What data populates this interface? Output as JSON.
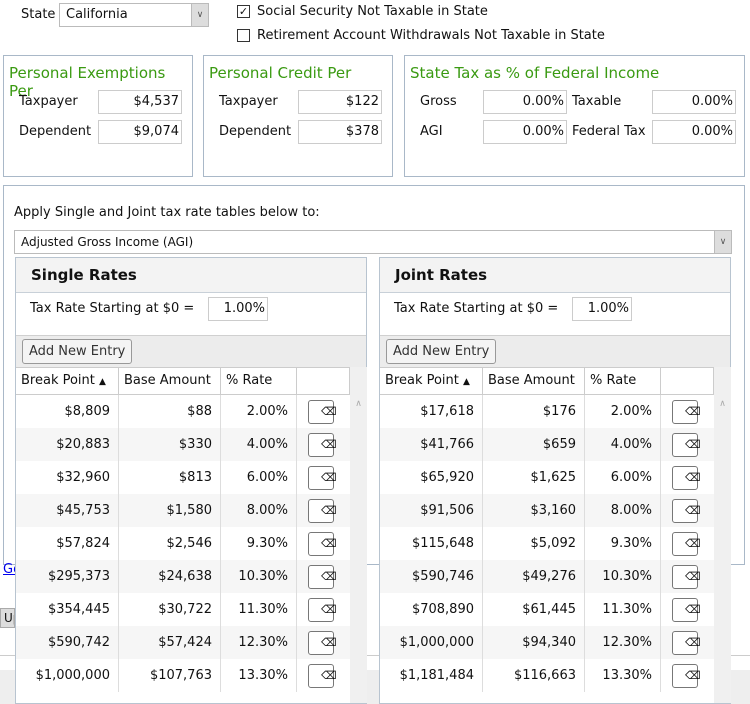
{
  "state": {
    "label": "State",
    "value": "California"
  },
  "options": [
    {
      "label": "Social Security Not Taxable in State",
      "checked": true
    },
    {
      "label": "Retirement Account Withdrawals Not Taxable in State",
      "checked": false
    }
  ],
  "exemptions": {
    "title": "Personal Exemptions Per",
    "taxpayer_label": "Taxpayer",
    "taxpayer": "$4,537",
    "dependent_label": "Dependent",
    "dependent": "$9,074"
  },
  "credit": {
    "title": "Personal Credit Per",
    "taxpayer_label": "Taxpayer",
    "taxpayer": "$122",
    "dependent_label": "Dependent",
    "dependent": "$378"
  },
  "statepct": {
    "title": "State Tax as % of Federal Income",
    "gross_label": "Gross",
    "gross": "0.00%",
    "agi_label": "AGI",
    "agi": "0.00%",
    "taxable_label": "Taxable",
    "taxable": "0.00%",
    "fedtax_label": "Federal Tax",
    "fedtax": "0.00%"
  },
  "apply": {
    "label": "Apply Single and Joint tax rate tables below to:",
    "value": "Adjusted Gross Income (AGI)"
  },
  "background": {
    "link": "Go",
    "button": "Up"
  },
  "columns": {
    "break": "Break Point",
    "base": "Base Amount",
    "rate": "% Rate"
  },
  "add_label": "Add New Entry",
  "rate_start_label": "Tax Rate Starting at $0 =",
  "single": {
    "title": "Single Rates",
    "start_rate": "1.00%",
    "rows": [
      [
        "$8,809",
        "$88",
        "2.00%"
      ],
      [
        "$20,883",
        "$330",
        "4.00%"
      ],
      [
        "$32,960",
        "$813",
        "6.00%"
      ],
      [
        "$45,753",
        "$1,580",
        "8.00%"
      ],
      [
        "$57,824",
        "$2,546",
        "9.30%"
      ],
      [
        "$295,373",
        "$24,638",
        "10.30%"
      ],
      [
        "$354,445",
        "$30,722",
        "11.30%"
      ],
      [
        "$590,742",
        "$57,424",
        "12.30%"
      ],
      [
        "$1,000,000",
        "$107,763",
        "13.30%"
      ]
    ]
  },
  "joint": {
    "title": "Joint Rates",
    "start_rate": "1.00%",
    "rows": [
      [
        "$17,618",
        "$176",
        "2.00%"
      ],
      [
        "$41,766",
        "$659",
        "4.00%"
      ],
      [
        "$65,920",
        "$1,625",
        "6.00%"
      ],
      [
        "$91,506",
        "$3,160",
        "8.00%"
      ],
      [
        "$115,648",
        "$5,092",
        "9.30%"
      ],
      [
        "$590,746",
        "$49,276",
        "10.30%"
      ],
      [
        "$708,890",
        "$61,445",
        "11.30%"
      ],
      [
        "$1,000,000",
        "$94,340",
        "12.30%"
      ],
      [
        "$1,181,484",
        "$116,663",
        "13.30%"
      ]
    ]
  }
}
